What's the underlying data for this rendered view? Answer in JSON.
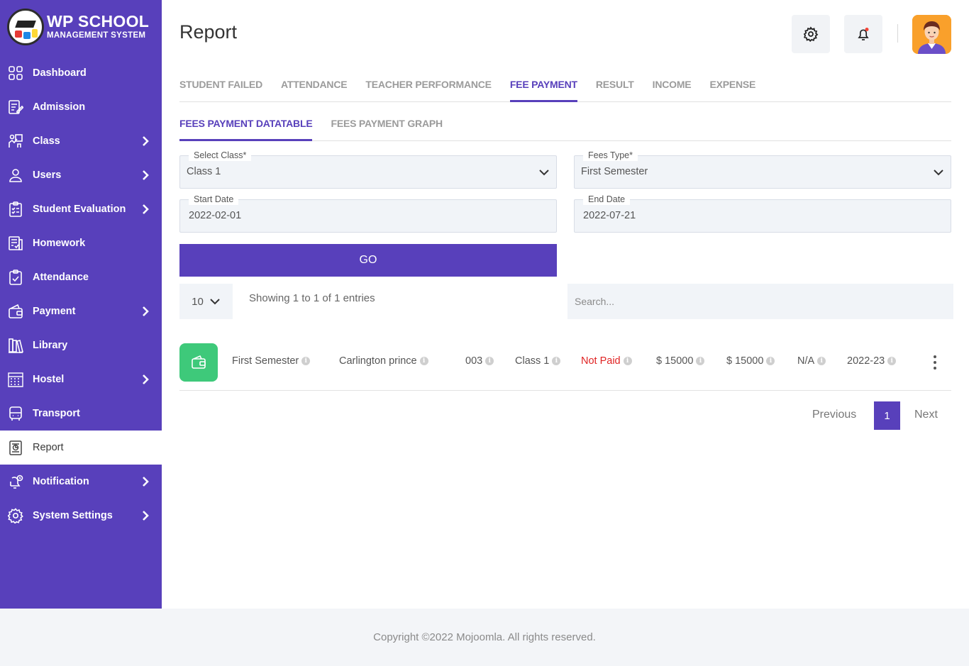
{
  "brand": {
    "title": "WP SCHOOL",
    "subtitle": "MANAGEMENT SYSTEM"
  },
  "sidebar": {
    "items": [
      {
        "label": "Dashboard",
        "icon": "dashboard-icon",
        "has_submenu": false
      },
      {
        "label": "Admission",
        "icon": "admission-icon",
        "has_submenu": false
      },
      {
        "label": "Class",
        "icon": "class-icon",
        "has_submenu": true
      },
      {
        "label": "Users",
        "icon": "user-icon",
        "has_submenu": true
      },
      {
        "label": "Student Evaluation",
        "icon": "evaluation-icon",
        "has_submenu": true
      },
      {
        "label": "Homework",
        "icon": "homework-icon",
        "has_submenu": false
      },
      {
        "label": "Attendance",
        "icon": "attendance-icon",
        "has_submenu": false
      },
      {
        "label": "Payment",
        "icon": "wallet-icon",
        "has_submenu": true
      },
      {
        "label": "Library",
        "icon": "library-icon",
        "has_submenu": false
      },
      {
        "label": "Hostel",
        "icon": "hostel-icon",
        "has_submenu": true
      },
      {
        "label": "Transport",
        "icon": "bus-icon",
        "has_submenu": false
      },
      {
        "label": "Report",
        "icon": "report-icon",
        "has_submenu": false,
        "active": true
      },
      {
        "label": "Notification",
        "icon": "notification-icon",
        "has_submenu": true
      },
      {
        "label": "System Settings",
        "icon": "settings-icon",
        "has_submenu": true
      }
    ]
  },
  "header": {
    "title": "Report"
  },
  "tabs": [
    "STUDENT FAILED",
    "ATTENDANCE",
    "TEACHER PERFORMANCE",
    "FEE PAYMENT",
    "RESULT",
    "INCOME",
    "EXPENSE"
  ],
  "active_tab": "FEE PAYMENT",
  "subtabs": [
    "FEES PAYMENT DATATABLE",
    "FEES PAYMENT GRAPH"
  ],
  "active_subtab": "FEES PAYMENT DATATABLE",
  "form": {
    "class_label": "Select Class*",
    "class_value": "Class 1",
    "fees_type_label": "Fees Type*",
    "fees_type_value": "First Semester",
    "start_label": "Start Date",
    "start_value": "2022-02-01",
    "end_label": "End Date",
    "end_value": "2022-07-21",
    "go_label": "GO"
  },
  "table": {
    "page_length": "10",
    "info": "Showing 1 to 1 of 1 entries",
    "search_placeholder": "Search...",
    "row": {
      "fees_type": "First Semester",
      "student": "Carlington prince",
      "roll": "003",
      "class": "Class 1",
      "status": "Not Paid",
      "amount": "$ 15000",
      "due": "$ 15000",
      "description": "N/A",
      "year": "2022-23"
    }
  },
  "pagination": {
    "previous": "Previous",
    "current": "1",
    "next": "Next"
  },
  "footer": {
    "text": "Copyright ©2022 Mojoomla. All rights reserved."
  },
  "colors": {
    "primary": "#5840bb",
    "success": "#3ec97a",
    "danger": "#e02424",
    "avatar_bg": "#f9a02b"
  }
}
